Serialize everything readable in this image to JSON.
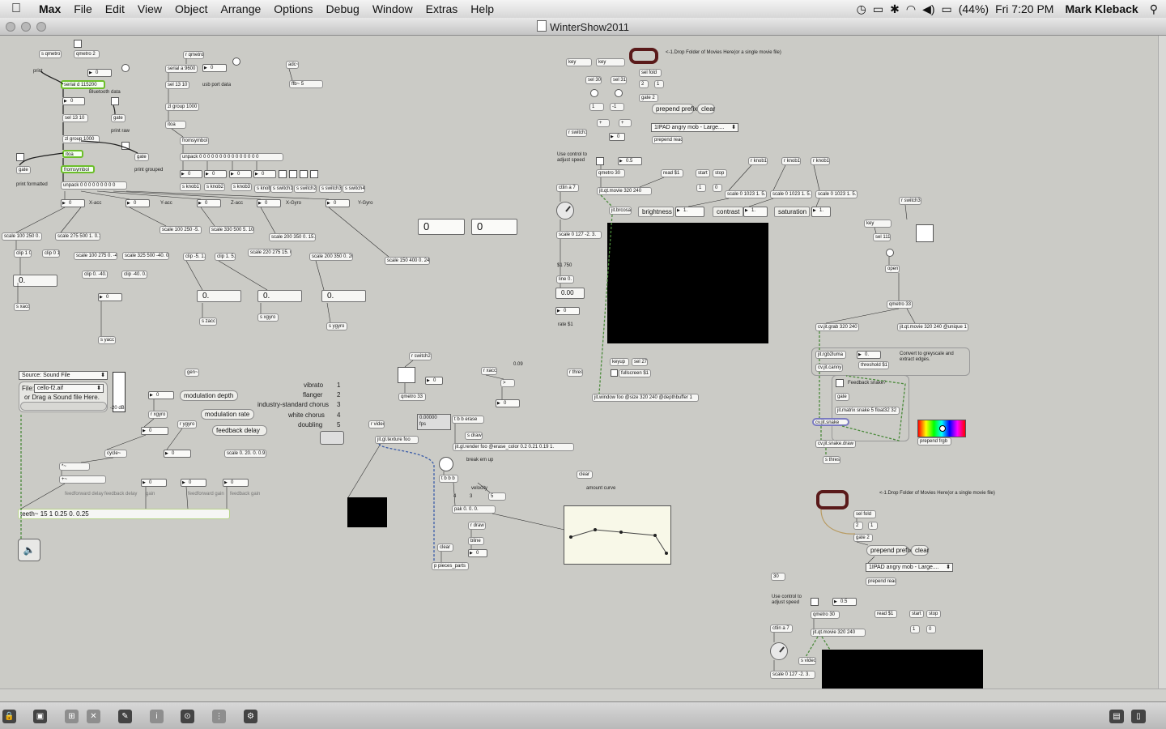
{
  "menubar": {
    "app": "Max",
    "items": [
      "File",
      "Edit",
      "View",
      "Object",
      "Arrange",
      "Options",
      "Debug",
      "Window",
      "Extras",
      "Help"
    ],
    "battery": "(44%)",
    "clock": "Fri 7:20 PM",
    "user": "Mark Kleback"
  },
  "window": {
    "title": "WinterShow2011"
  },
  "patch": {
    "serial": {
      "s_qmetro": "s qmetro",
      "qmetro2": "qmetro 2",
      "print": "print",
      "serial_d": "serial d 115200",
      "bt_data": "Bluetooth data",
      "sel": "sel 13 10",
      "gate1": "gate",
      "print_raw": "print raw",
      "zl_group": "zl group 1000",
      "itoa": "itoa",
      "gate2": "gate",
      "gate3": "gate",
      "print_grouped": "print grouped",
      "print_formatted": "print formatted",
      "fromsymbol": "fromsymbol",
      "unpack": "unpack 0 0 0 0 0 0 0 0 0",
      "x_acc": "X-acc",
      "y_acc": "Y-acc",
      "z_acc": "Z-acc",
      "x_gyro": "X-Gyro",
      "y_gyro": "Y-Gyro",
      "zero": "0"
    },
    "usb": {
      "r_qmetro": "r qmetro",
      "serial_a": "serial a 9600",
      "sel": "sel 13 10",
      "usb_data": "usb port data",
      "zl_group": "zl group 1000",
      "itoa": "itoa",
      "fromsymbol": "fromsymbol",
      "unpack": "unpack 0 0 0 0 0 0 0 0 0 0 0 0 0 0 0",
      "s_knob1": "s knob1",
      "s_knob2": "s knob2",
      "s_knob3": "s knob3",
      "s_knob": "s knob",
      "s_switch1": "s switch1",
      "s_switch2": "s switch2",
      "s_switch3": "s switch3",
      "s_switch4": "s switch4",
      "adc": "adc~",
      "ffb": "ffb~ 5"
    },
    "scales": {
      "s1": "scale 100 250 0. 1.",
      "s2": "scale 275 500 1. 0.1",
      "s3": "scale 100 250 -5. -2.",
      "s4": "scale 330 500 5. 10.",
      "s5": "scale 200 350 0. 15.",
      "s6": "scale 100 275 0. -40.",
      "s7": "scale 325 500 -40. 0.",
      "s8": "scale 220 275 15. 0.",
      "s9": "scale 200 350 0. 20.",
      "s10": "scale 150 400 0. 240.",
      "clip1": "clip 1 0",
      "clip2": "clip 0 1",
      "clip3": "clip 0. -40.",
      "clip4": "clip -40. 0.",
      "clip5": "clip -5. 1.",
      "clip6": "clip 1. 5.",
      "f0": "0.",
      "s_xacc": "s xacc",
      "s_yacc": "s yacc",
      "s_zacc": "s zacc",
      "s_xgyro": "s xgyro",
      "s_ygyro": "s ygyro"
    },
    "audio": {
      "source": "Source: Sound File",
      "file": "cello-f2.aif",
      "drop": "or Drag a Sound file Here.",
      "db": "-20 dB",
      "gen": "gen~",
      "mod_depth": "modulation depth",
      "mod_rate": "modulation rate",
      "fb_delay": "feedback delay",
      "r_xgyro": "r xgyro",
      "r_ygyro": "r ygyro",
      "cycle": "cycle~",
      "scale": "scale 0. 20. 0. 0.9",
      "ff_delay": "feedforward delay",
      "fb_delay2": "feedback delay",
      "gain": "gain",
      "ff_gain": "feedforward gain",
      "fb_gain": "feedback gain",
      "teeth": "teeth~ 15 1 0.25 0. 0.25",
      "presets": [
        {
          "name": "vibrato",
          "n": "1"
        },
        {
          "name": "flanger",
          "n": "2"
        },
        {
          "name": "industry-standard chorus",
          "n": "3"
        },
        {
          "name": "white chorus",
          "n": "4"
        },
        {
          "name": "doubling",
          "n": "5"
        }
      ]
    },
    "gl": {
      "r_switch2": "r switch2",
      "r_xacc": "r xacc",
      "v009": "0.09",
      "qmetro33": "qmetro 33",
      "fps_val": "0.00000",
      "fps": "fps",
      "tbb_erase": "t b b erase",
      "s_draw": "s draw",
      "r_video": "r video",
      "texture": "jit.gl.texture foo",
      "render": "jit.gl.render foo @erase_color 0.2 0.21 0.19 1.",
      "break": "break em up",
      "tbbb": "t b b b",
      "velocity": "velocity",
      "v4": "4",
      "v3": "3",
      "v5": "5",
      "pak": "pak 0. 0. 0.",
      "r_draw": "r draw",
      "bline": "bline",
      "clear": "clear",
      "pieces": "p pieces_parts",
      "clear2": "clear",
      "amount": "amount curve"
    },
    "movie": {
      "key1": "key",
      "key2": "key",
      "sel30": "sel 30",
      "sel31": "sel 31",
      "m1": "1",
      "mminus1": "-1",
      "drop": "<-1.Drop Folder of Movies Here(or a single movie file)",
      "sel_fold": "sel fold",
      "c2": "2",
      "c1": "1",
      "gate2": "gate 2",
      "prepend_prefix": "prepend prefix",
      "clear": "clear",
      "menu": "1IPAD angry mob - Large....",
      "prepend_read": "prepend read",
      "r_switch1": "r switch1",
      "use_ctl": "Use control to adjust speed",
      "ctlin": "ctlin a 7",
      "v05": "0.5",
      "qmetro30": "qmetro 30",
      "read": "read $1",
      "start": "start",
      "stop": "stop",
      "r_knob1a": "r knob1",
      "r_knob1b": "r knob1",
      "r_knob1c": "r knob1",
      "one": "1",
      "zero": "0",
      "sc1": "scale 0 1023 1. 5.",
      "sc2": "scale 0 1023 1. 5.",
      "sc3": "scale 0 1023 1. 5.",
      "qtmovie": "jit.qt.movie 320 240",
      "brcosa": "jit.brcosa",
      "brightness": "brightness",
      "contrast": "contrast",
      "saturation": "saturation",
      "v1": "1.",
      "scale127": "scale 0 127 -2. 3.",
      "d1750": "$1 750",
      "line0": "line 0.",
      "f000": "0.00",
      "rate": "rate $1",
      "keyup": "keyup",
      "sel27": "sel 27",
      "fullscreen": "fullscreen $1",
      "r_thres": "r thres",
      "window": "jit.window foo @size 320 240 @depthbuffer 1"
    },
    "cv": {
      "r_switch3": "r switch3",
      "key": "key",
      "sel111": "sel 111",
      "open": "open",
      "qmetro33": "qmetro 33",
      "grab": "cv.jit.grab 320 240",
      "qtmovie": "jit.qt.movie 320 240 @unique 1",
      "rgb2luma": "jit.rgb2luma",
      "f0": "0.",
      "canny": "cv.jit.canny",
      "threshold": "threshold $1",
      "convert": "Convert to greyscale and extract edges.",
      "feedback": "Feedback snake?",
      "gate": "gate",
      "matrix": "jit.matrix snake 5 float32 32",
      "snake": "cv.jit.snake",
      "draw": "cv.jit.snake.draw",
      "s_thres": "s thres",
      "prepend_frgb": "prepend frgb"
    },
    "movie2": {
      "drop": "<-1.Drop Folder of Movies Here(or a single movie file)",
      "sel_fold": "sel fold",
      "c2": "2",
      "c1": "1",
      "gate2": "gate 2",
      "prepend_prefix": "prepend prefix",
      "clear": "clear",
      "menu": "1IPAD angry mob - Large....",
      "prepend_read": "prepend read",
      "v30": "30",
      "use_ctl": "Use control to adjust speed",
      "ctlin": "ctlin a 7",
      "v05": "0.5",
      "qmetro30": "qmetro 30",
      "read": "read $1",
      "start": "start",
      "stop": "stop",
      "one": "1",
      "zero": "0",
      "qtmovie": "jit.qt.movie 320 240",
      "s_video": "s video",
      "scale127": "scale 0 127 -2. 3."
    }
  }
}
